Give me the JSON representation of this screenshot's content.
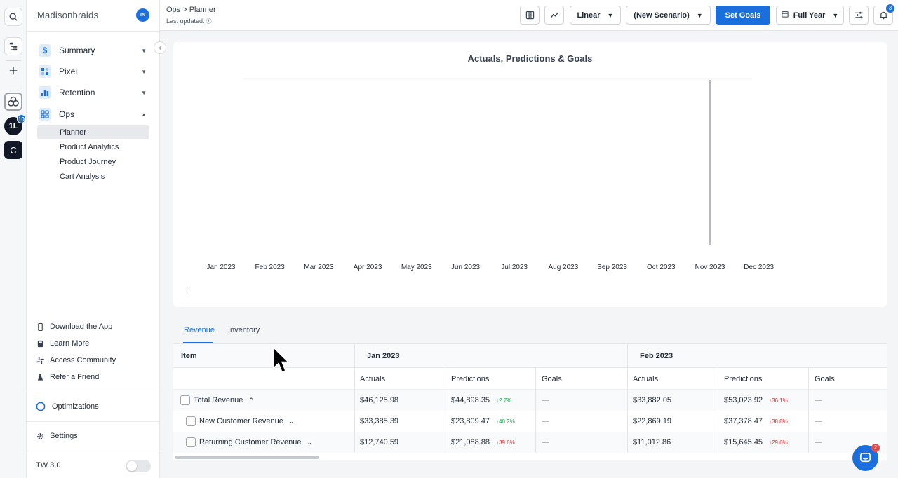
{
  "brand": {
    "name": "Madisonbraids",
    "avatar_initials": "IN"
  },
  "rail": {
    "notification_count": "10",
    "app_c_label": "C"
  },
  "nav": [
    {
      "label": "Summary",
      "icon": "dollar-icon",
      "expanded": false
    },
    {
      "label": "Pixel",
      "icon": "pixel-icon",
      "expanded": false
    },
    {
      "label": "Retention",
      "icon": "bar-chart-icon",
      "expanded": false
    },
    {
      "label": "Ops",
      "icon": "grid-icon",
      "expanded": true
    }
  ],
  "ops_sub": [
    "Planner",
    "Product Analytics",
    "Product Journey",
    "Cart Analysis"
  ],
  "footer_links": [
    "Download the App",
    "Learn More",
    "Access Community",
    "Refer a Friend"
  ],
  "optimizations": "Optimizations",
  "settings": "Settings",
  "version": "TW 3.0",
  "header": {
    "breadcrumb": "Ops > Planner",
    "last_updated": "Last updated:",
    "scale": "Linear",
    "scenario": "(New Scenario)",
    "set_goals": "Set Goals",
    "period": "Full Year",
    "bell_count": "3"
  },
  "chart_data": {
    "type": "line",
    "title": "Actuals, Predictions & Goals",
    "x": [
      "Jan 2023",
      "Feb 2023",
      "Mar 2023",
      "Apr 2023",
      "May 2023",
      "Jun 2023",
      "Jul 2023",
      "Aug 2023",
      "Sep 2023",
      "Oct 2023",
      "Nov 2023",
      "Dec 2023"
    ],
    "series": [],
    "grid": true,
    "marker_at": "Nov 2023",
    "footnote": ";"
  },
  "tabs": [
    "Revenue",
    "Inventory"
  ],
  "table": {
    "item_header": "Item",
    "months": [
      "Jan 2023",
      "Feb 2023"
    ],
    "sub_headers": [
      "Actuals",
      "Predictions",
      "Goals"
    ],
    "rows": [
      {
        "label": "Total Revenue",
        "indent": false,
        "jan": {
          "actuals": "$46,125.98",
          "pred": "$44,898.35",
          "chg": "2.7%",
          "dir": "up",
          "goals": "—"
        },
        "feb": {
          "actuals": "$33,882.05",
          "pred": "$53,023.92",
          "chg": "36.1%",
          "dir": "down",
          "goals": "—"
        }
      },
      {
        "label": "New Customer Revenue",
        "indent": true,
        "jan": {
          "actuals": "$33,385.39",
          "pred": "$23,809.47",
          "chg": "40.2%",
          "dir": "up",
          "goals": "—"
        },
        "feb": {
          "actuals": "$22,869.19",
          "pred": "$37,378.47",
          "chg": "38.8%",
          "dir": "down",
          "goals": "—"
        }
      },
      {
        "label": "Returning Customer Revenue",
        "indent": true,
        "jan": {
          "actuals": "$12,740.59",
          "pred": "$21,088.88",
          "chg": "39.6%",
          "dir": "down",
          "goals": "—"
        },
        "feb": {
          "actuals": "$11,012.86",
          "pred": "$15,645.45",
          "chg": "29.6%",
          "dir": "down",
          "goals": "—"
        }
      }
    ]
  },
  "help_badge": "2",
  "colors": {
    "accent": "#1a6fdc",
    "up": "#16a34a",
    "down": "#dc2626"
  }
}
